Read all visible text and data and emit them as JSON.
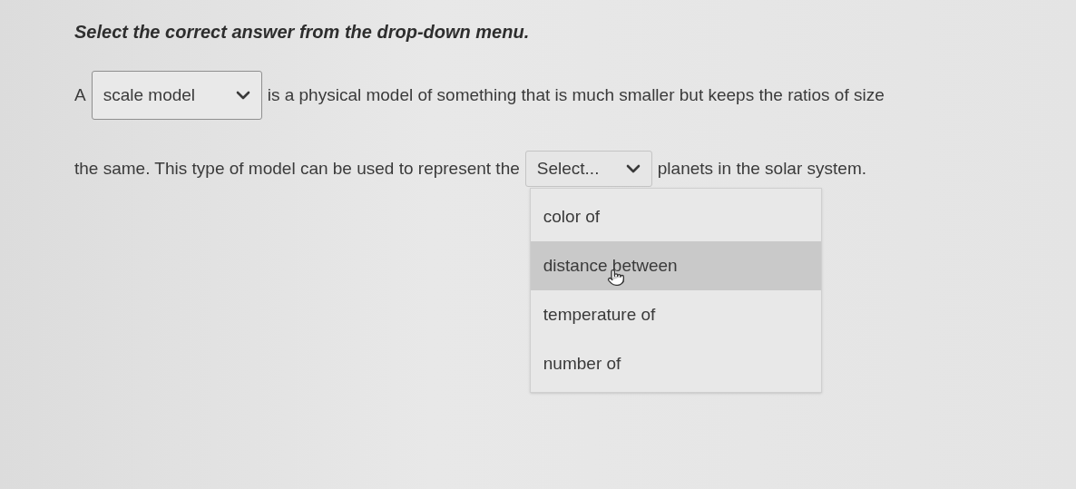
{
  "instruction": "Select the correct answer from the drop-down menu.",
  "lines": [
    [
      {
        "kind": "text",
        "text": "A"
      },
      {
        "kind": "dropdown",
        "value": "scale model",
        "expanded": false
      },
      {
        "kind": "text",
        "text": "is a physical model of something that is much smaller but keeps the ratios of size"
      }
    ],
    [
      {
        "kind": "text",
        "text": "the same. This type of model can be used to represent the"
      },
      {
        "kind": "dropdown",
        "value": "Select...",
        "expanded": true,
        "options": [
          {
            "label": "color of",
            "selected": false
          },
          {
            "label": "distance between",
            "selected": true
          },
          {
            "label": "temperature of",
            "selected": false
          },
          {
            "label": "number of",
            "selected": false
          }
        ]
      },
      {
        "kind": "text",
        "text": "planets in the solar system."
      }
    ]
  ]
}
